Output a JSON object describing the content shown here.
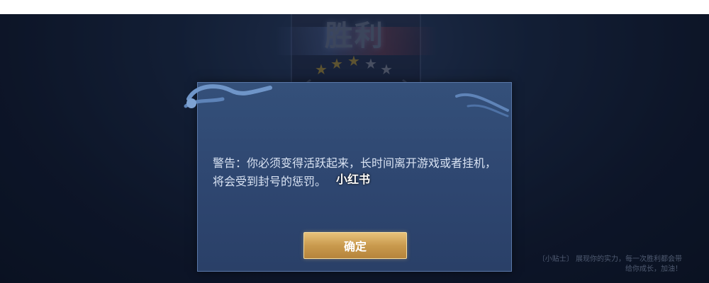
{
  "background": {
    "victory_title": "胜利",
    "star_colors": {
      "gold": "#8c7a3e",
      "silver": "#6c7488"
    }
  },
  "dialog": {
    "message": "警告：你必须变得活跃起来，长时间离开游戏或者挂机，将会受到封号的惩罚。",
    "confirm_label": "确定",
    "watermark": "小红书"
  },
  "corner_text": "〔小贴士〕 展现你的实力，每一次胜利都会带给你成长，加油！",
  "colors": {
    "dialog_bg": "#2e4670",
    "button_gold": "#c99a4e",
    "text": "#d8e2f2"
  }
}
